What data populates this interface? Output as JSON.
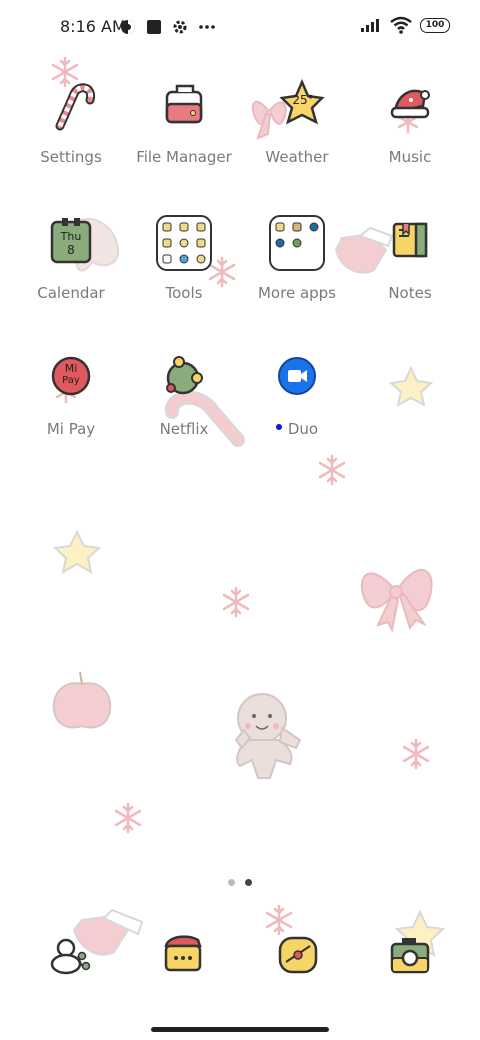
{
  "status_bar": {
    "time": "8:16 AM",
    "left_icons": [
      "vpn-icon",
      "square-icon",
      "gear-icon",
      "more-dots-icon"
    ],
    "right_icons": [
      "signal-icon",
      "wifi-icon"
    ],
    "battery": "100"
  },
  "apps": [
    {
      "name": "settings",
      "label": "Settings"
    },
    {
      "name": "file-manager",
      "label": "File Manager"
    },
    {
      "name": "weather",
      "label": "Weather",
      "temp": "25°"
    },
    {
      "name": "music",
      "label": "Music"
    },
    {
      "name": "calendar",
      "label": "Calendar",
      "day": "Thu",
      "date": "8"
    },
    {
      "name": "tools",
      "label": "Tools"
    },
    {
      "name": "more-apps",
      "label": "More apps"
    },
    {
      "name": "notes",
      "label": "Notes"
    },
    {
      "name": "mi-pay",
      "label": "Mi Pay",
      "icon_text1": "Mi",
      "icon_text2": "Pay"
    },
    {
      "name": "netflix",
      "label": "Netflix"
    },
    {
      "name": "duo",
      "label": "Duo"
    }
  ],
  "page_indicator": {
    "pages": 2,
    "current": 2
  },
  "colors": {
    "label": "#7a7a7a",
    "duo_blue": "#1a73e8",
    "wallpaper_pink": "#f1c9cc",
    "star_yellow": "#fdf0c2"
  }
}
